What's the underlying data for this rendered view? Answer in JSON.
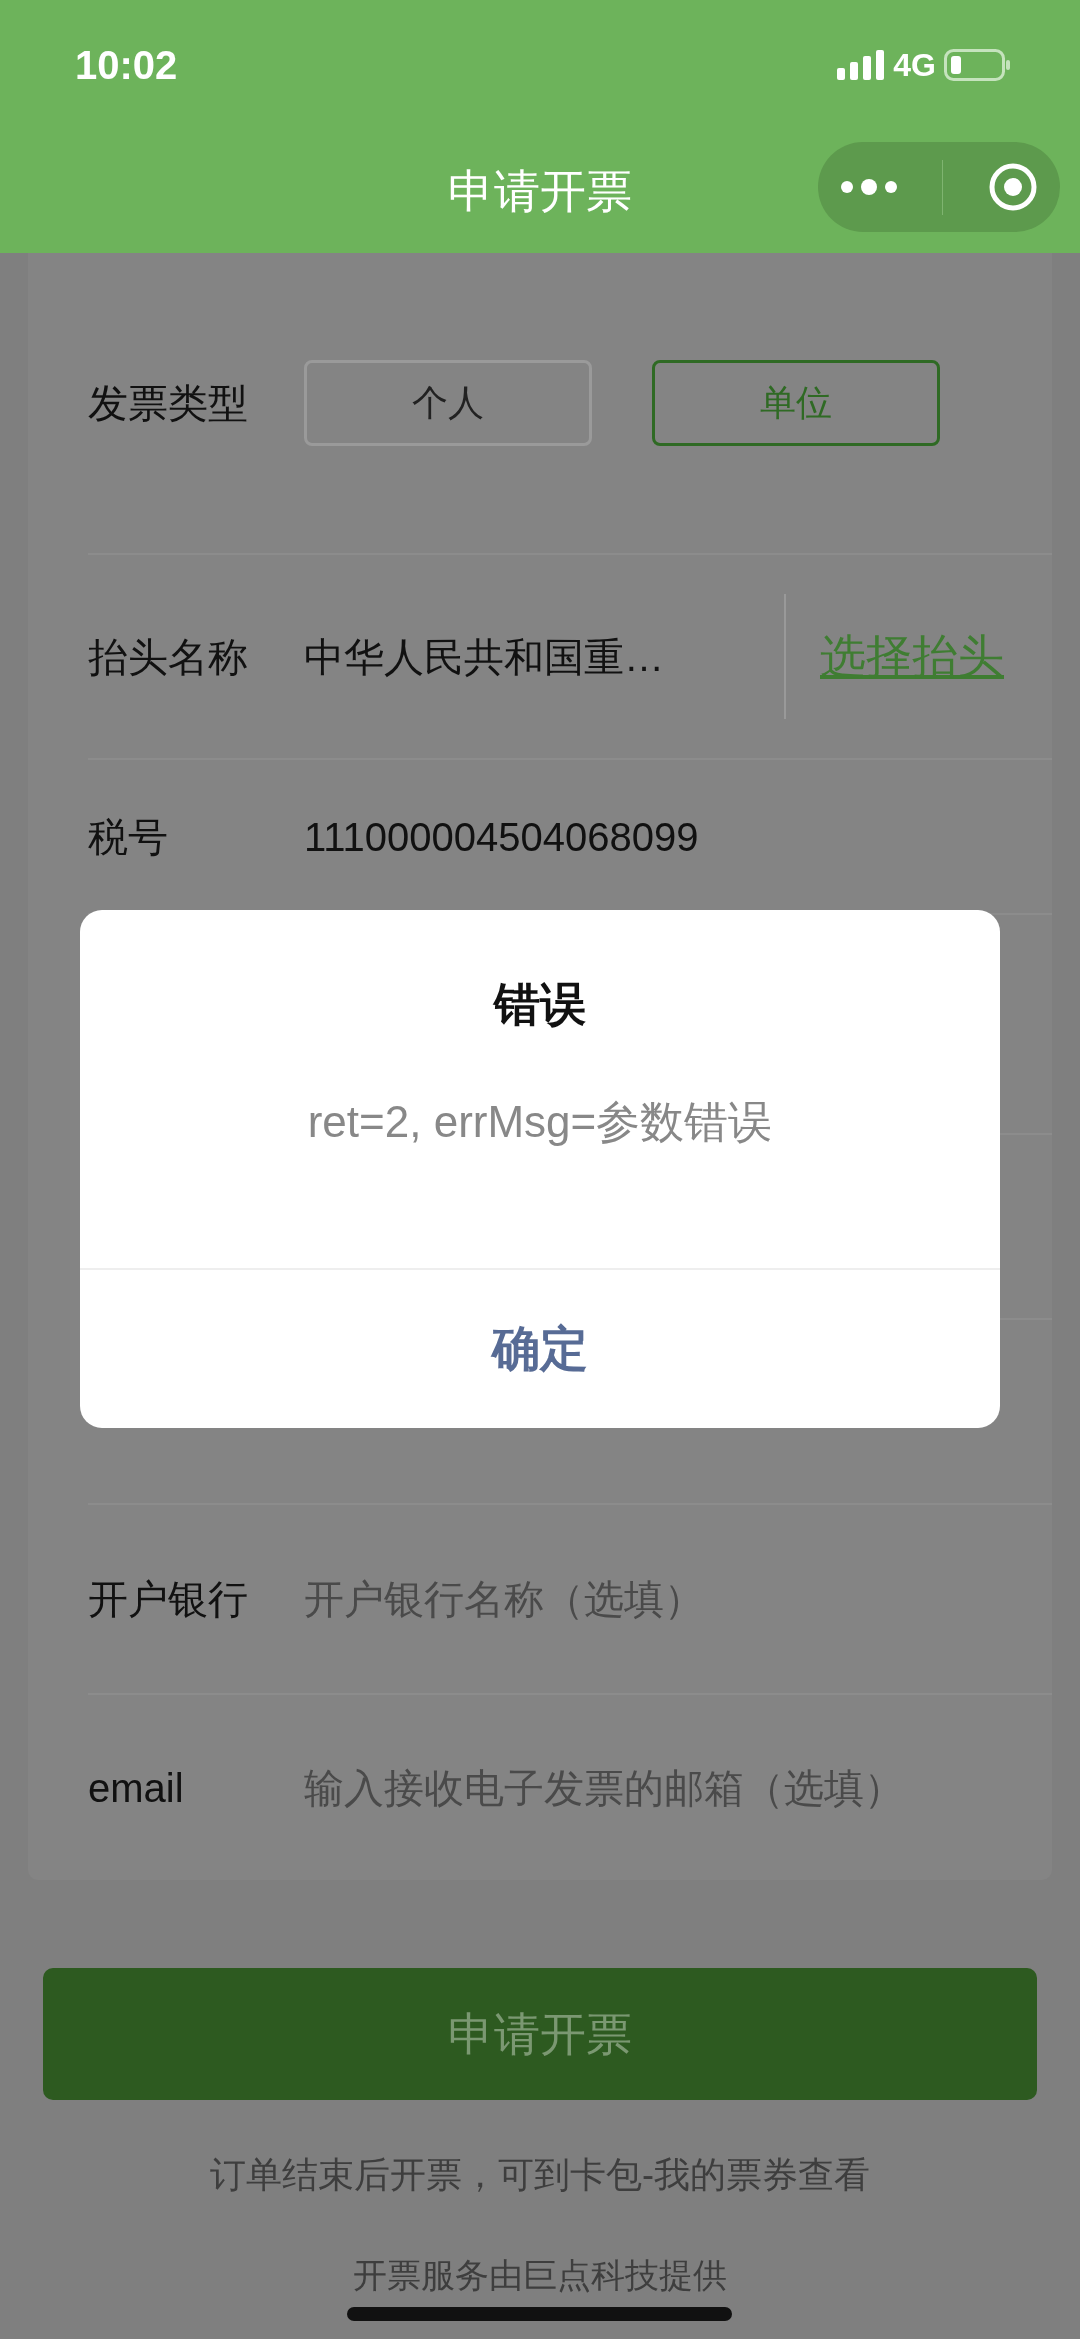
{
  "status_bar": {
    "time": "10:02",
    "network": "4G"
  },
  "nav_bar": {
    "title": "申请开票"
  },
  "form": {
    "invoice_type": {
      "label": "发票类型",
      "options": [
        {
          "label": "个人",
          "selected": false
        },
        {
          "label": "单位",
          "selected": true
        }
      ]
    },
    "title_name": {
      "label": "抬头名称",
      "value": "中华人民共和国重…",
      "action": "选择抬头"
    },
    "tax_number": {
      "label": "税号",
      "value": "111000004504068099"
    },
    "bank": {
      "label": "开户银行",
      "placeholder": "开户银行名称（选填）"
    },
    "email": {
      "label": "email",
      "placeholder": "输入接收电子发票的邮箱（选填）"
    }
  },
  "submit_button": "申请开票",
  "note": "订单结束后开票，可到卡包-我的票券查看",
  "provider": "开票服务由巨点科技提供",
  "dialog": {
    "title": "错误",
    "message": "ret=2, errMsg=参数错误",
    "button": "确定"
  }
}
